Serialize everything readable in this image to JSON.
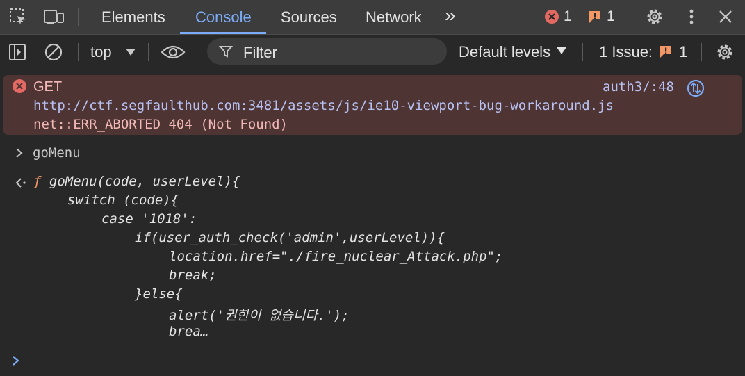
{
  "tabs": {
    "elements": "Elements",
    "console": "Console",
    "sources": "Sources",
    "network": "Network",
    "more": "»"
  },
  "counts": {
    "errors": "1",
    "warnings": "1"
  },
  "toolbar": {
    "context": "top",
    "filter_placeholder": "Filter",
    "levels": "Default levels",
    "issues_label": "1 Issue:",
    "issues_count": "1"
  },
  "error": {
    "method": "GET",
    "url": "http://ctf.segfaulthub.com:3481/assets/js/ie10-viewport-bug-workaround.js",
    "status": "net::ERR_ABORTED 404 (Not Found)",
    "source": "auth3/:48"
  },
  "command": {
    "text": "goMenu"
  },
  "result": {
    "f_marker": "ƒ",
    "lines": [
      "goMenu(code, userLevel){",
      "switch (code){",
      "case '1018':",
      "if(user_auth_check('admin',userLevel)){",
      "location.href=\"./fire_nuclear_Attack.php\";",
      "break;",
      "}else{",
      "alert('권한이 없습니다.');",
      "brea…"
    ]
  },
  "colors": {
    "accent": "#7cacf8",
    "error_bg": "#4e3534",
    "error_text": "#f2b8b5",
    "warning": "#f29766"
  }
}
